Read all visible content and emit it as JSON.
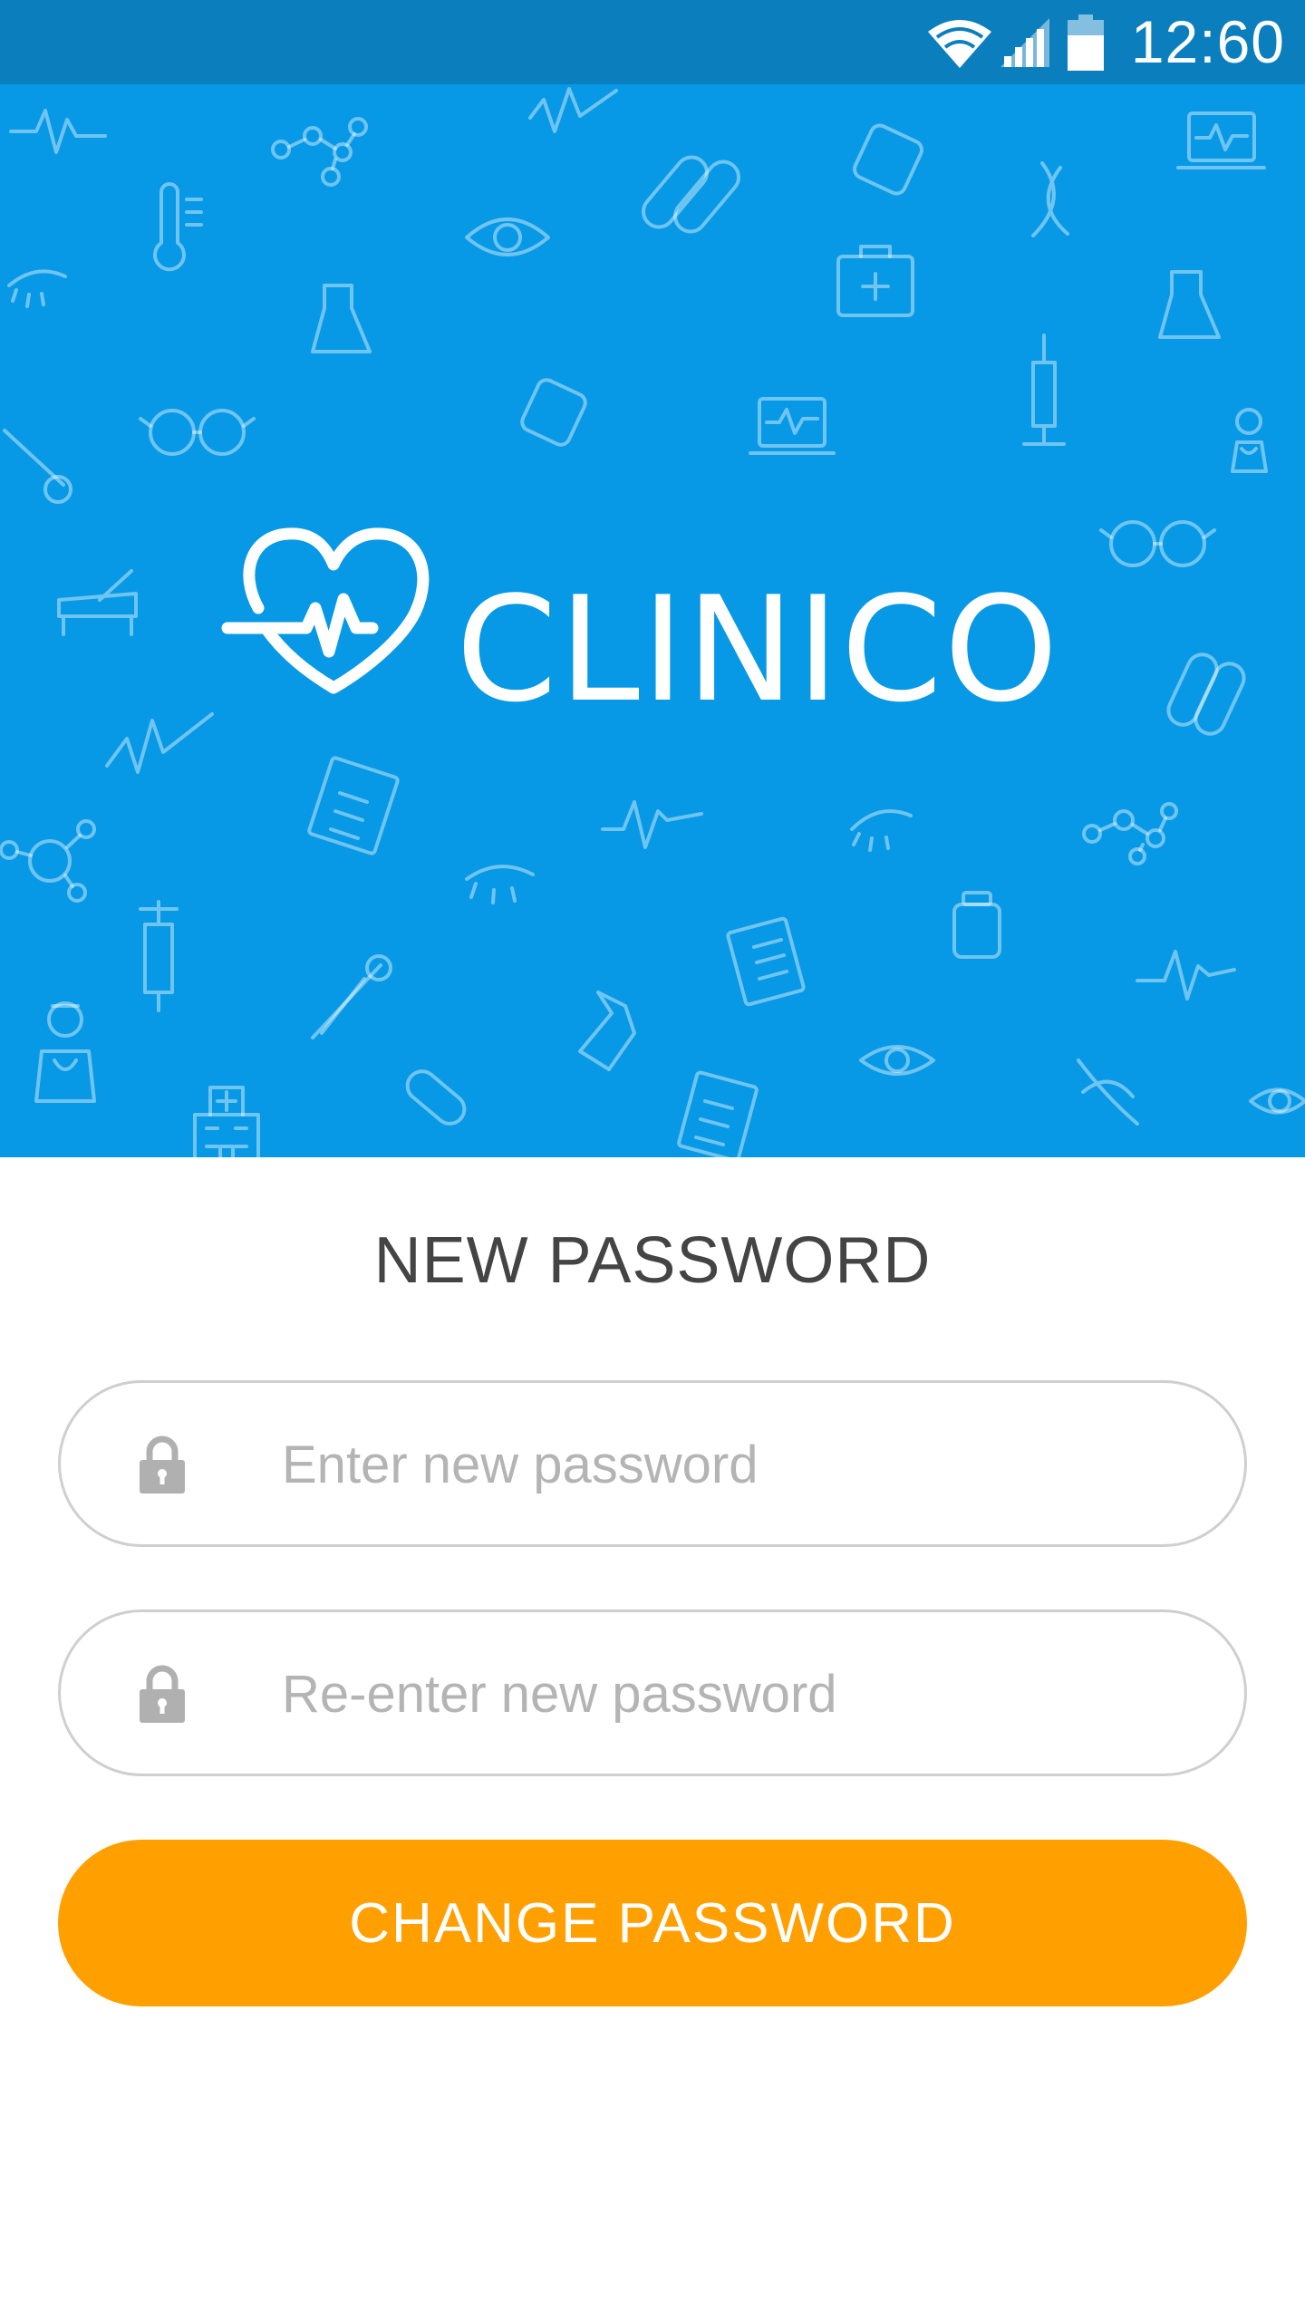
{
  "status_bar": {
    "time": "12:60",
    "icons": [
      "wifi-icon",
      "cellular-signal-icon",
      "battery-icon"
    ],
    "background_color": "#0b7fbe"
  },
  "hero": {
    "background_color": "#0799e6",
    "brand_name": "CLINICO",
    "logo_icon": "heart-pulse-icon"
  },
  "form": {
    "title": "NEW PASSWORD",
    "new_password": {
      "placeholder": "Enter new password",
      "value": "",
      "icon": "lock-icon"
    },
    "confirm_password": {
      "placeholder": "Re-enter new password",
      "value": "",
      "icon": "lock-icon"
    },
    "submit_label": "CHANGE PASSWORD"
  },
  "colors": {
    "accent": "#ff9f00",
    "title_text": "#444444",
    "placeholder_text": "#b4b4b4",
    "field_border": "#cfcfcf"
  }
}
